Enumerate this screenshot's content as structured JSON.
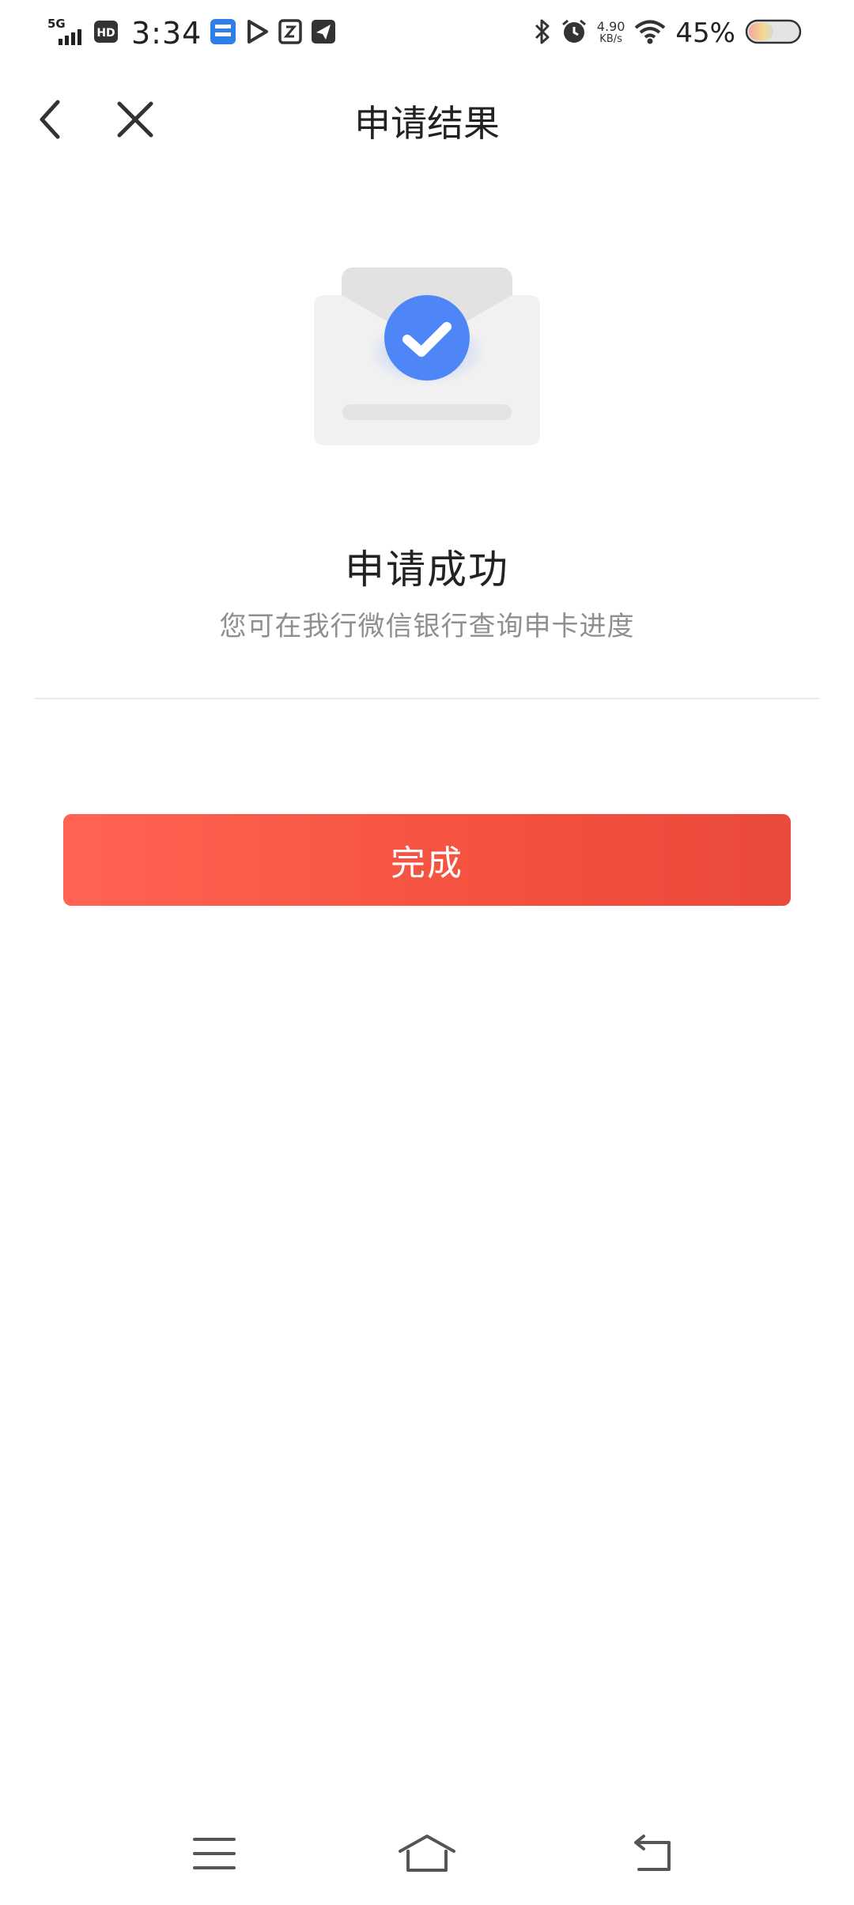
{
  "status_bar": {
    "network": "5G",
    "hd": "HD",
    "time": "3:34",
    "speed_value": "4.90",
    "speed_unit": "KB/s",
    "battery_percent": "45%",
    "icons": [
      "signal-icon",
      "hd-icon",
      "app-notification-icon",
      "play-icon",
      "note-icon",
      "send-icon",
      "bluetooth-icon",
      "alarm-icon",
      "wifi-icon",
      "battery-icon"
    ]
  },
  "header": {
    "back_icon": "chevron-left-icon",
    "close_icon": "close-icon",
    "title": "申请结果"
  },
  "result": {
    "icon": "envelope-check-icon",
    "title": "申请成功",
    "subtitle": "您可在我行微信银行查询申卡进度"
  },
  "actions": {
    "done_label": "完成"
  },
  "colors": {
    "accent": "#f4513f",
    "check_circle": "#4f86f7",
    "subtitle": "#8f8f8f"
  },
  "nav_bar": {
    "icons": [
      "menu-icon",
      "home-icon",
      "back-icon"
    ]
  }
}
